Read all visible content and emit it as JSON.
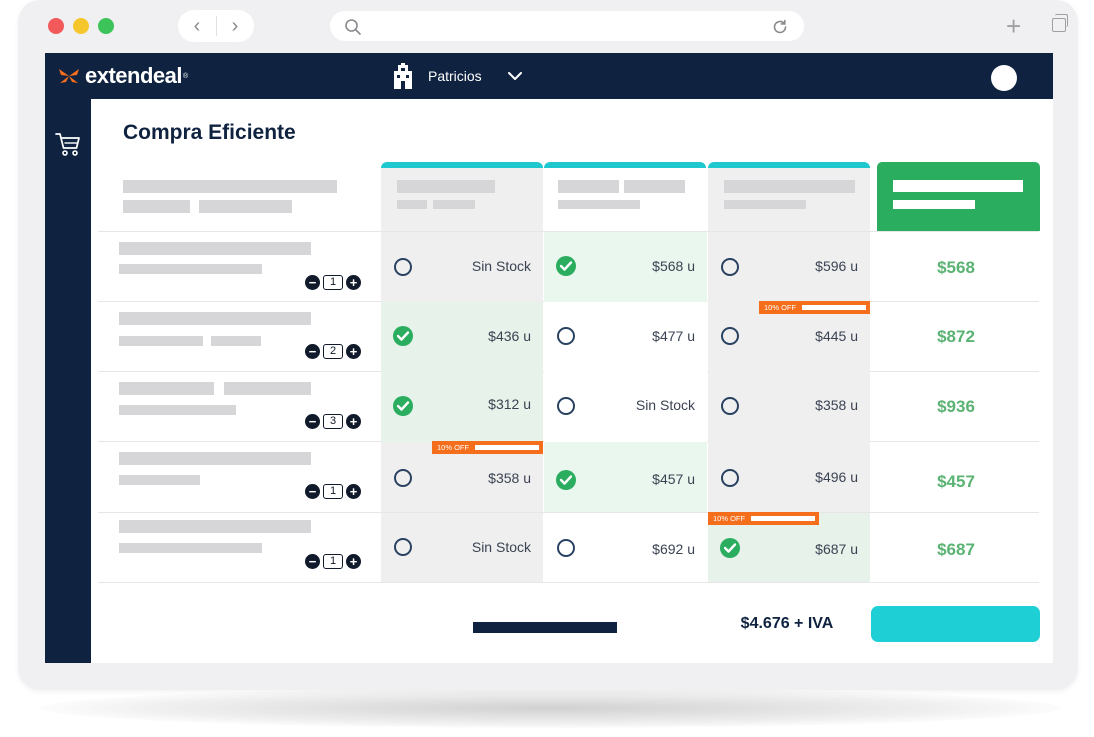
{
  "browser": {
    "window_controls": [
      "close",
      "minimize",
      "maximize"
    ],
    "colors": {
      "close": "#f2595a",
      "minimize": "#f5c72d",
      "maximize": "#3cc35a"
    }
  },
  "brand": {
    "name": "extendeal",
    "registered": "®",
    "accent": "#f46e1b",
    "navy": "#0f2340"
  },
  "header": {
    "store_name": "Patricios"
  },
  "page": {
    "title": "Compra Eficiente"
  },
  "suppliers": [
    {
      "id": "s1"
    },
    {
      "id": "s2"
    },
    {
      "id": "s3"
    }
  ],
  "products": [
    {
      "qty": "1",
      "offers": [
        {
          "price": "Sin Stock",
          "selected": false
        },
        {
          "price": "$568 u",
          "selected": true
        },
        {
          "price": "$596 u",
          "selected": false
        }
      ],
      "total": "$568"
    },
    {
      "qty": "2",
      "offers": [
        {
          "price": "$436 u",
          "selected": true
        },
        {
          "price": "$477 u",
          "selected": false
        },
        {
          "price": "$445 u",
          "selected": false,
          "badge": "10% OFF"
        }
      ],
      "total": "$872"
    },
    {
      "qty": "3",
      "offers": [
        {
          "price": "$312 u",
          "selected": true
        },
        {
          "price": "Sin Stock",
          "selected": false
        },
        {
          "price": "$358 u",
          "selected": false
        }
      ],
      "total": "$936"
    },
    {
      "qty": "1",
      "offers": [
        {
          "price": "$358 u",
          "selected": false,
          "badge": "10% OFF"
        },
        {
          "price": "$457 u",
          "selected": true
        },
        {
          "price": "$496 u",
          "selected": false
        }
      ],
      "total": "$457"
    },
    {
      "qty": "1",
      "offers": [
        {
          "price": "Sin Stock",
          "selected": false
        },
        {
          "price": "$692 u",
          "selected": false
        },
        {
          "price": "$687 u",
          "selected": true,
          "badge": "10% OFF"
        }
      ],
      "total": "$687"
    }
  ],
  "footer": {
    "grand_total": "$4.676 + IVA"
  },
  "colors": {
    "selected": "#2bad5f",
    "column_accent": "#1fc7cf",
    "cta": "#1fcfd6",
    "total_text": "#5bb373"
  },
  "icons": {
    "search": "search-icon",
    "reload": "reload-icon",
    "cart": "cart-icon",
    "store": "store-icon"
  }
}
